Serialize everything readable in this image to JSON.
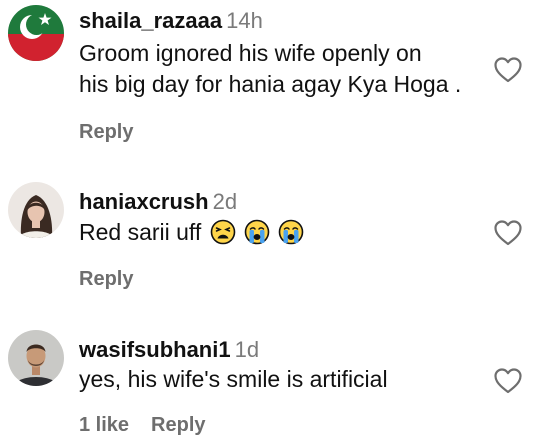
{
  "comments": [
    {
      "username": "shaila_razaaa",
      "time": "14h",
      "line1": "Groom ignored his wife openly on",
      "line2": "his big day for hania agay Kya Hoga .",
      "likes": "",
      "reply_label": "Reply",
      "avatar_icon": "pti-flag-avatar"
    },
    {
      "username": "haniaxcrush",
      "time": "2d",
      "text": "Red sarii uff",
      "emojis": [
        "weary-face",
        "loudly-crying-face",
        "loudly-crying-face"
      ],
      "likes": "",
      "reply_label": "Reply",
      "avatar_icon": "profile-photo-avatar"
    },
    {
      "username": "wasifsubhani1",
      "time": "1d",
      "text": "yes, his wife's smile is artificial",
      "likes": "1 like",
      "reply_label": "Reply",
      "avatar_icon": "profile-photo-avatar"
    }
  ],
  "colors": {
    "username": "#111111",
    "timestamp": "#7a7a7a",
    "action_text": "#6e6e6e",
    "heart_stroke": "#6e6e6e",
    "flag_green": "#1f7a3c",
    "flag_red": "#d1222f"
  }
}
